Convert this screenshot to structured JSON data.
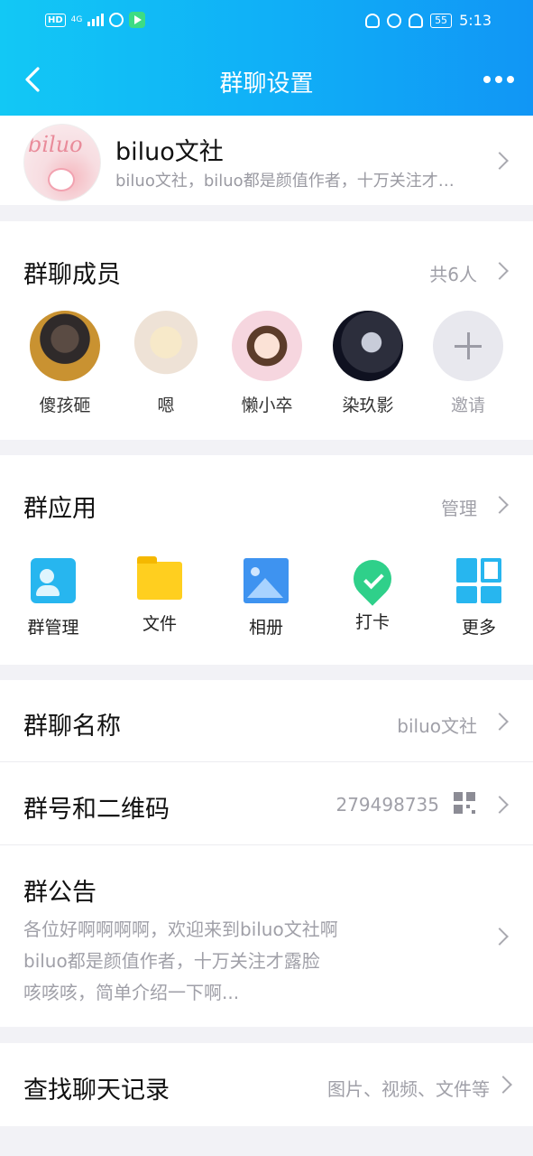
{
  "status_bar": {
    "network": "HD",
    "network_gen": "4G",
    "battery": "55",
    "time": "5:13"
  },
  "nav": {
    "title": "群聊设置"
  },
  "group": {
    "avatar_logo": "biluo",
    "name": "biluo文社",
    "description": "biluo文社，biluo都是颜值作者，十万关注才…"
  },
  "members": {
    "title": "群聊成员",
    "count": "共6人",
    "items": [
      {
        "name": "傻孩砸"
      },
      {
        "name": "嗯"
      },
      {
        "name": "懒小卒"
      },
      {
        "name": "染玖影"
      },
      {
        "name": "邀请"
      }
    ]
  },
  "apps": {
    "title": "群应用",
    "manage": "管理",
    "items": [
      {
        "label": "群管理",
        "icon": "group-manage-icon"
      },
      {
        "label": "文件",
        "icon": "folder-icon"
      },
      {
        "label": "相册",
        "icon": "photo-icon"
      },
      {
        "label": "打卡",
        "icon": "check-in-icon"
      },
      {
        "label": "更多",
        "icon": "more-apps-icon"
      }
    ]
  },
  "settings": {
    "name_label": "群聊名称",
    "name_value": "biluo文社",
    "number_label": "群号和二维码",
    "number_value": "279498735",
    "notice_label": "群公告",
    "notice_lines": [
      "各位好啊啊啊啊，欢迎来到biluo文社啊",
      "biluo都是颜值作者，十万关注才露脸",
      "咳咳咳，简单介绍一下啊..."
    ],
    "search_label": "查找聊天记录",
    "search_value": "图片、视频、文件等"
  }
}
